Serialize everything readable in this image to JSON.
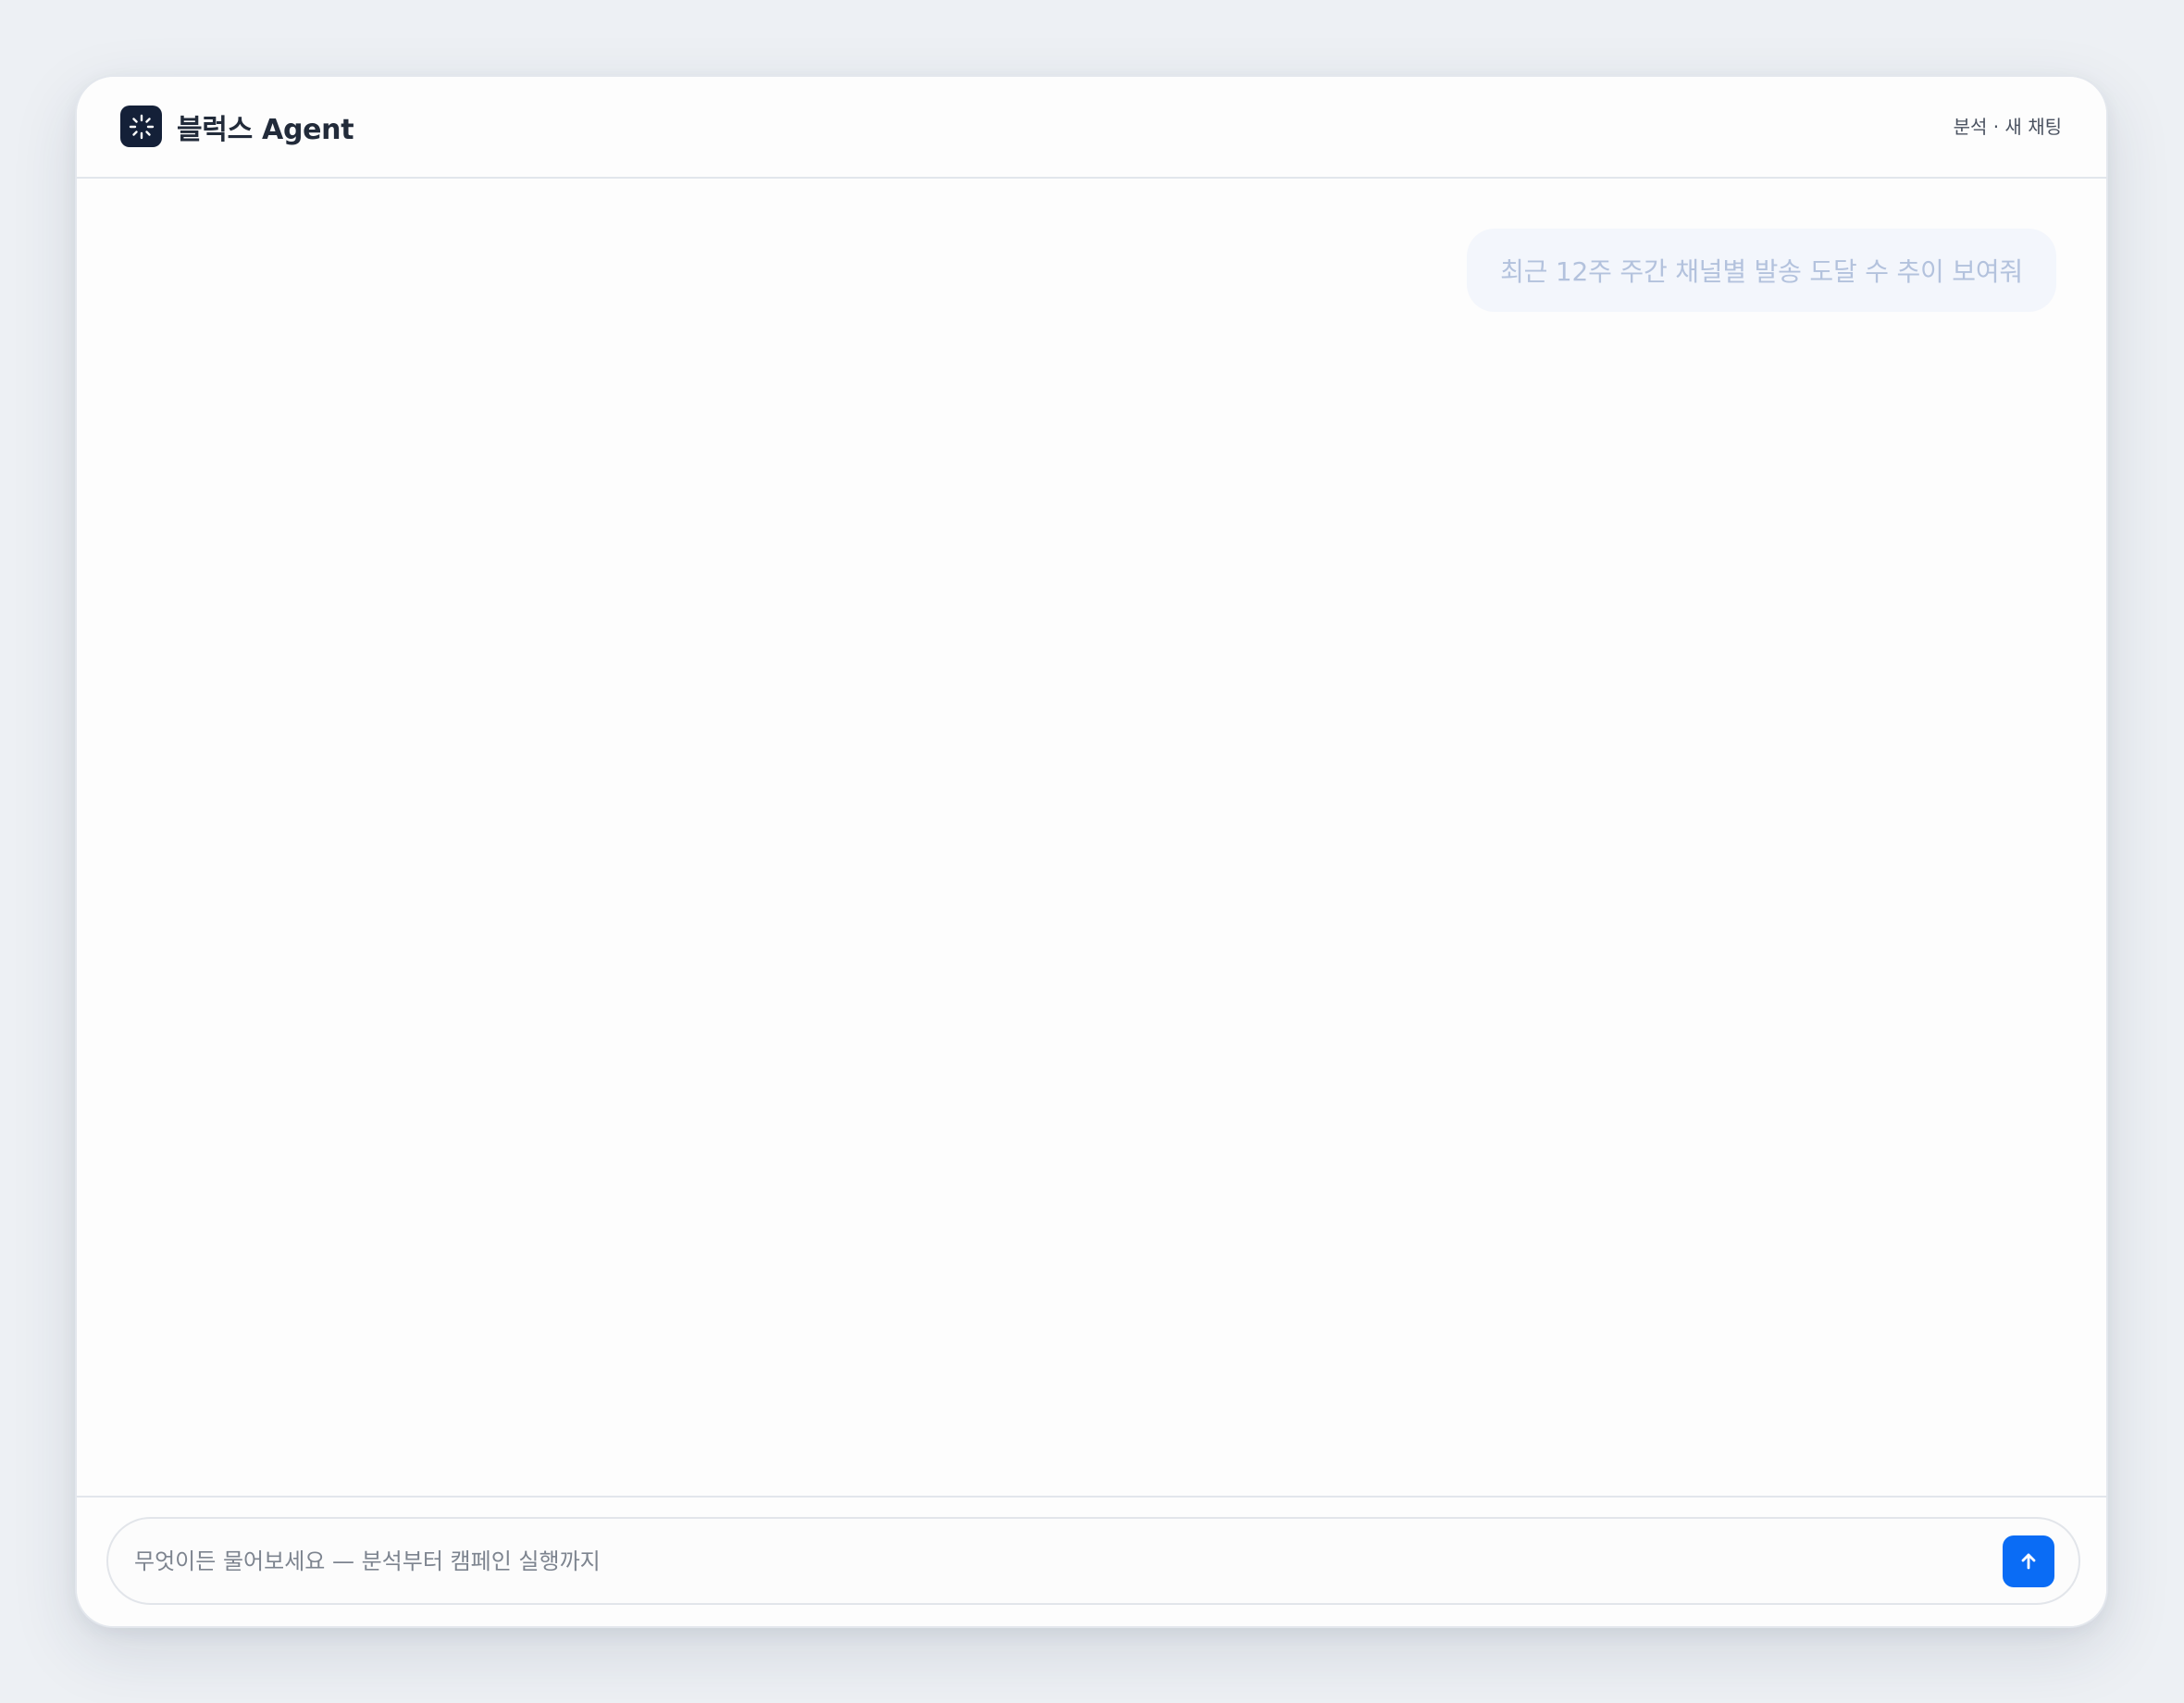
{
  "header": {
    "logo_icon": "sparkle-burst-icon",
    "app_name": "블럭스 Agent",
    "context_label": "분석 · 새 채팅"
  },
  "chat": {
    "messages": [
      {
        "role": "user",
        "text": "최근 12주 주간 채널별 발송 도달 수 추이 보여줘"
      }
    ]
  },
  "composer": {
    "placeholder": "무엇이든 물어보세요 — 분석부터 캠페인 실행까지",
    "value": "",
    "send_icon": "arrow-up-icon"
  },
  "colors": {
    "page_background": "#edf0f4",
    "logo_background": "#142038",
    "accent": "#0a6cf5",
    "user_bubble_background": "#f3f6fc",
    "user_bubble_text": "#b3c2dd"
  }
}
